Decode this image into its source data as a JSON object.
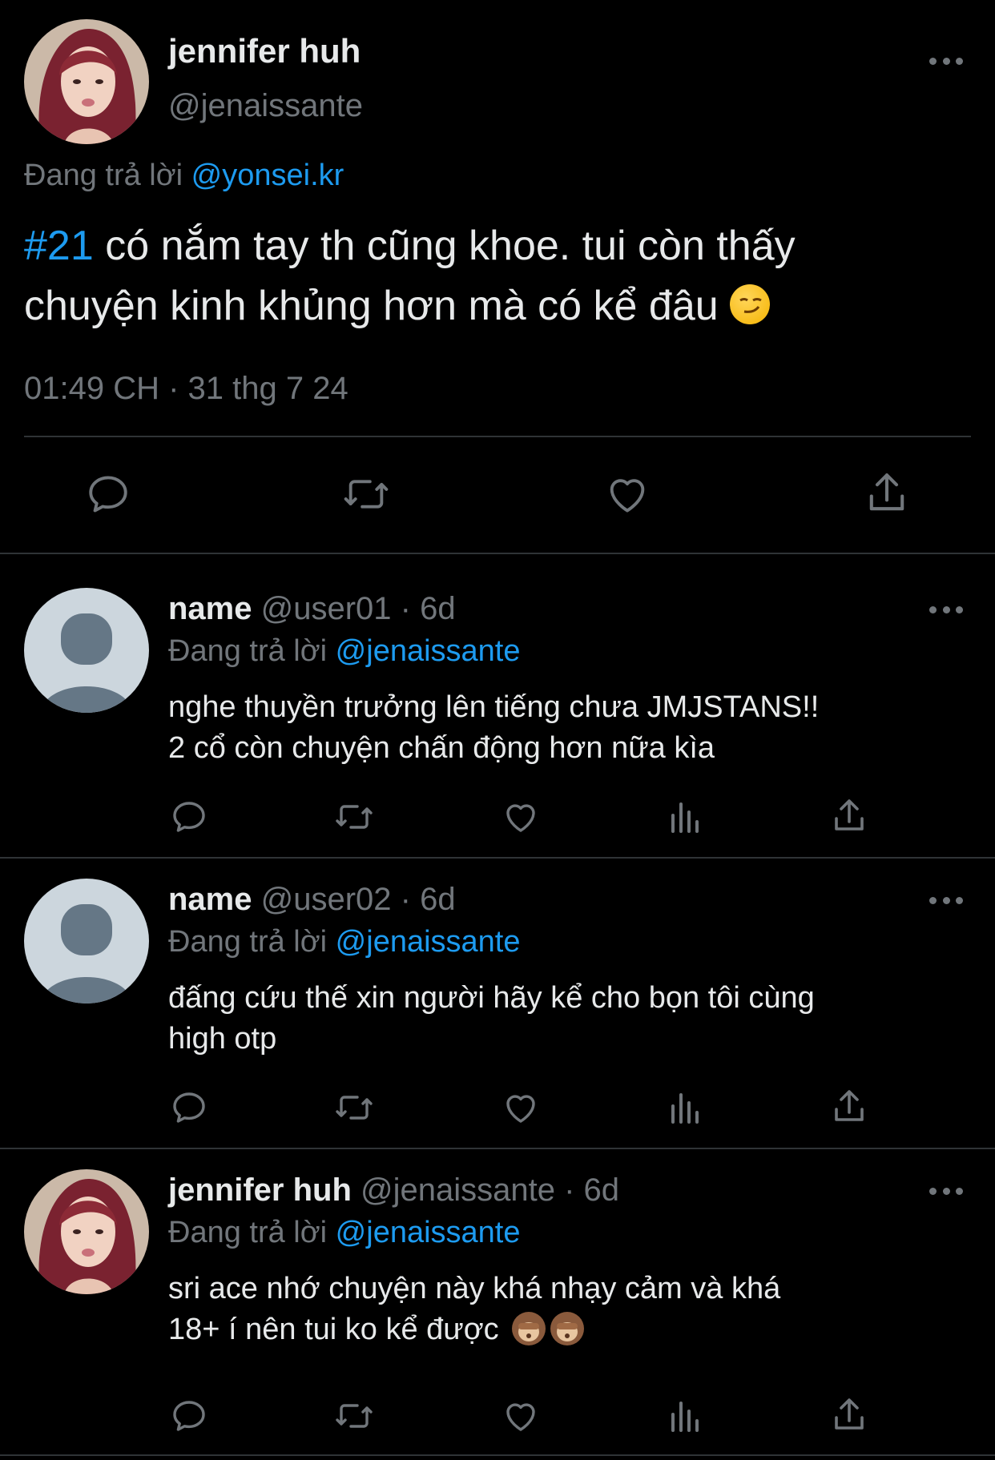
{
  "main_tweet": {
    "author_name": "jennifer huh",
    "author_handle": "@jenaissante",
    "reply_prefix": "Đang trả lời",
    "reply_to": "@yonsei.kr",
    "hashtag": "#21",
    "text_part1": " có nắm tay th cũng khoe. tui còn thấy",
    "text_part2": "chuyện kinh khủng hơn mà có kể đâu",
    "emoji": "smirking-face",
    "timestamp": "01:49 CH · 31 thg 7 24"
  },
  "replies": [
    {
      "name": "name",
      "meta": "@user01 · 6d",
      "reply_prefix": "Đang trả lời",
      "reply_to": "@jenaissante",
      "line1": "nghe thuyền trưởng lên tiếng chưa JMJSTANS!!",
      "line2": "2 cổ còn chuyện chấn động hơn nữa kìa"
    },
    {
      "name": "name",
      "meta": "@user02 · 6d",
      "reply_prefix": "Đang trả lời",
      "reply_to": "@jenaissante",
      "line1": "đấng cứu thế xin người hãy kể cho bọn tôi cùng",
      "line2": "high otp"
    },
    {
      "name": "jennifer huh",
      "meta": "@jenaissante · 6d",
      "reply_prefix": "Đang trả lời",
      "reply_to": "@jenaissante",
      "line1": "sri ace nhớ chuyện này khá nhạy cảm và khá",
      "line2": "18+ í nên tui ko kể được",
      "emoji": "see-no-evil-monkey"
    }
  ],
  "colors": {
    "background": "#000000",
    "text": "#e7e9ea",
    "muted": "#71767b",
    "link": "#1d9bf0",
    "divider": "#2f3336"
  }
}
